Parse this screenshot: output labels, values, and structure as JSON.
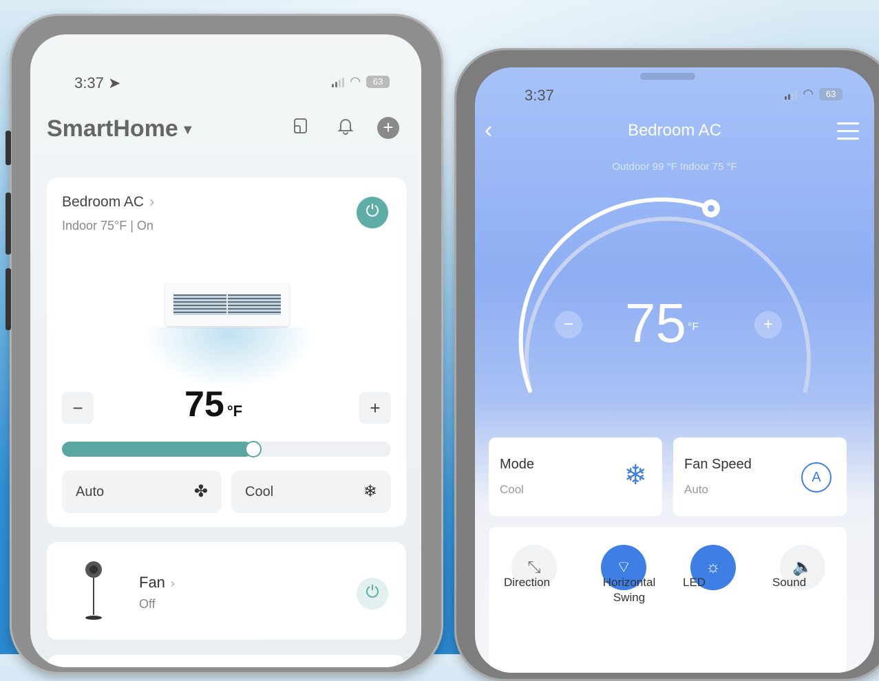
{
  "left_phone": {
    "status": {
      "time": "3:37",
      "battery": "63"
    },
    "header": {
      "title": "SmartHome"
    },
    "ac_card": {
      "name": "Bedroom AC",
      "status": "Indoor 75°F | On",
      "temperature": "75",
      "unit": "°F",
      "minus": "−",
      "plus": "+",
      "slider_fraction": 0.58,
      "modes": [
        {
          "label": "Auto",
          "icon": "fan-icon"
        },
        {
          "label": "Cool",
          "icon": "snowflake-icon"
        }
      ]
    },
    "fan_card": {
      "name": "Fan",
      "status": "Off"
    }
  },
  "right_phone": {
    "status": {
      "time": "3:37",
      "battery": "63"
    },
    "header": {
      "title": "Bedroom AC"
    },
    "subtitle": {
      "outdoor": "Outdoor 99 °F",
      "indoor": "Indoor 75 °F"
    },
    "dial": {
      "temperature": "75",
      "unit": "°F",
      "minus": "−",
      "plus": "+"
    },
    "mode": {
      "label": "Mode",
      "value": "Cool"
    },
    "fan_speed": {
      "label": "Fan Speed",
      "value": "Auto",
      "icon_letter": "A"
    },
    "controls": [
      {
        "label": "Direction",
        "active": false
      },
      {
        "label": "Horizontal Swing",
        "active": true
      },
      {
        "label": "LED",
        "active": true
      },
      {
        "label": "Sound",
        "active": false
      }
    ]
  },
  "colors": {
    "teal": "#5eaea7",
    "blue_accent": "#3e7fe6"
  }
}
